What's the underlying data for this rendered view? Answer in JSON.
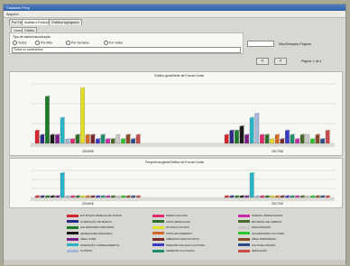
{
  "window": {
    "title": "Cadastro Prop"
  },
  "menu": {
    "item1": "Arquivo"
  },
  "tabs": [
    "Por Fase",
    "Análise e Evolução",
    "Gráficos Agregados"
  ],
  "subtabs": [
    "Dados",
    "Gráfico"
  ],
  "options": {
    "group_label": "Tipo de dados/visualização",
    "radios": [
      "Todos",
      "Por Mês",
      "Por Semana",
      "Por Safra"
    ]
  },
  "filter_field": {
    "value": "Todos os parâmetros"
  },
  "right_panel": {
    "pages_label": "Máx/Desejado Páginas",
    "page_text": "Página: 1 de 1"
  },
  "nav": {
    "prev": "<",
    "next": ">"
  },
  "chart1": {
    "title": "Gráfico geral/série de Forma Conta",
    "x_labels": [
      "2016/05",
      "2017/05"
    ]
  },
  "chart2": {
    "title": "Frequência geral/Gráfico de Forma Conta",
    "x_labels": [
      "2016/05",
      "2017/05"
    ]
  },
  "colors": {
    "series": [
      "#d4262a",
      "#2d2a8a",
      "#1c7a2a",
      "#1a1a1a",
      "#7a1f8a",
      "#2ab4c8",
      "#a8b6d8",
      "#e02a72",
      "#2f6e2b",
      "#e4e02a",
      "#d66a22",
      "#7a2a2a",
      "#3a3ac8",
      "#1e8e6c",
      "#c82aa8",
      "#4a6a2a",
      "#c8c8c8",
      "#2ac82a",
      "#8a4a2a",
      "#2a4a8a",
      "#c84a4a"
    ]
  },
  "chart_data": {
    "type": "bar",
    "categories": [
      "2016/05",
      "2017/05"
    ],
    "series": [
      {
        "values": [
          3,
          2
        ]
      },
      {
        "values": [
          2,
          3
        ]
      },
      {
        "values": [
          11,
          3
        ]
      },
      {
        "values": [
          2,
          4
        ]
      },
      {
        "values": [
          2,
          2
        ]
      },
      {
        "values": [
          6,
          6
        ]
      },
      {
        "values": [
          1,
          7
        ]
      },
      {
        "values": [
          1,
          2
        ]
      },
      {
        "values": [
          2,
          2
        ]
      },
      {
        "values": [
          13,
          1
        ]
      },
      {
        "values": [
          2,
          2
        ]
      },
      {
        "values": [
          2,
          1
        ]
      },
      {
        "values": [
          1,
          3
        ]
      },
      {
        "values": [
          2,
          2
        ]
      },
      {
        "values": [
          1,
          1
        ]
      },
      {
        "values": [
          1,
          2
        ]
      },
      {
        "values": [
          2,
          2
        ]
      },
      {
        "values": [
          1,
          1
        ]
      },
      {
        "values": [
          2,
          2
        ]
      },
      {
        "values": [
          1,
          1
        ]
      },
      {
        "values": [
          2,
          3
        ]
      }
    ],
    "chart2_values": [
      [
        0,
        0
      ],
      [
        0,
        0
      ],
      [
        0,
        0
      ],
      [
        0,
        0
      ],
      [
        0,
        0
      ],
      [
        9,
        9
      ],
      [
        0,
        0
      ],
      [
        0,
        0
      ],
      [
        0,
        0
      ],
      [
        0,
        0
      ],
      [
        0,
        0
      ],
      [
        0,
        0
      ],
      [
        0,
        0
      ],
      [
        0,
        0
      ],
      [
        0,
        0
      ],
      [
        0,
        0
      ],
      [
        0,
        0
      ],
      [
        0,
        0
      ],
      [
        0,
        0
      ],
      [
        0,
        0
      ],
      [
        0,
        0
      ]
    ]
  },
  "legend": [
    "EXTRAÇÃO IRREGULAR TRANS.",
    "ALTERAÇÃO DE MARCO",
    "AGUARDANDO REFORMA",
    "SEMEADURA ATRASADA",
    "ÁREA LIVRE",
    "OPERAÇÃO CARREGAMENTO",
    "OUTROS",
    "PERDA CULTIVO",
    "PODA IRREGULAR",
    "OUTRAS CAUSAS",
    "PISTA EM PREPARO",
    "LIBERADA PARA PLANTIO",
    "PREPARO DE SOLO CULTURA",
    "SEMENTE CULTIVADA",
    "ATRASO OPERACIONAL",
    "RETIRADA DE SOBRAS",
    "MANUTENÇÃO",
    "AGUARDANDO CULTURA",
    "ÁREA PREPARADA",
    "FALTA DE INSUMO",
    "IRRIGAÇÃO"
  ],
  "footer": {
    "ok": "",
    "cancel": ""
  }
}
